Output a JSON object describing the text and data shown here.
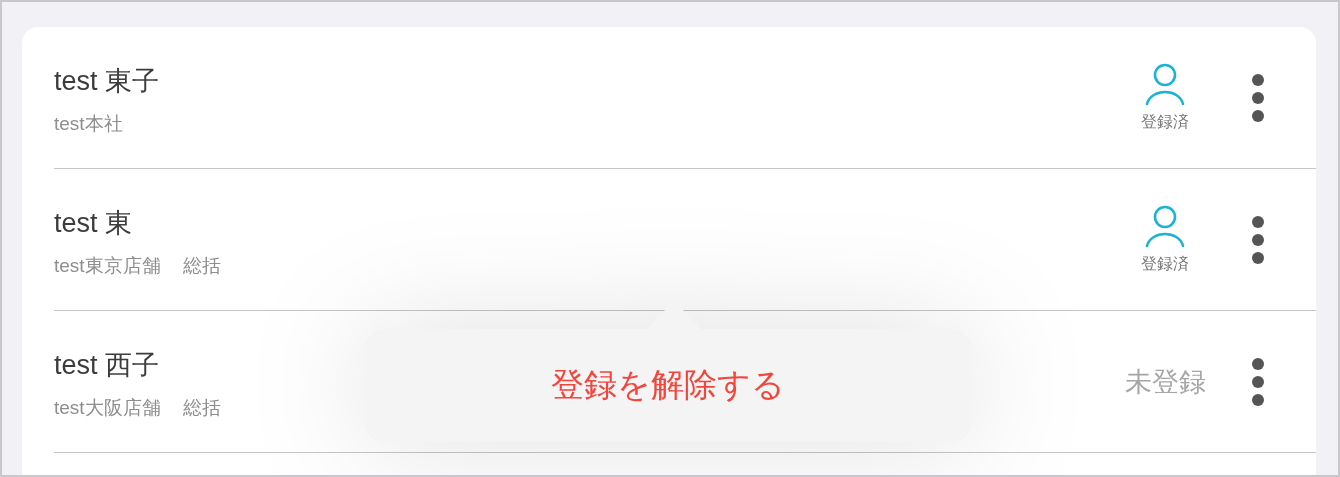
{
  "rows": [
    {
      "name": "test 東子",
      "affiliation": [
        "test本社"
      ],
      "registered": true,
      "status": "登録済"
    },
    {
      "name": "test 東",
      "affiliation": [
        "test東京店舗",
        "総括"
      ],
      "registered": true,
      "status": "登録済"
    },
    {
      "name": "test 西子",
      "affiliation": [
        "test大阪店舗",
        "総括"
      ],
      "registered": false,
      "status": "未登録"
    }
  ],
  "popover": {
    "action": "登録を解除する"
  }
}
